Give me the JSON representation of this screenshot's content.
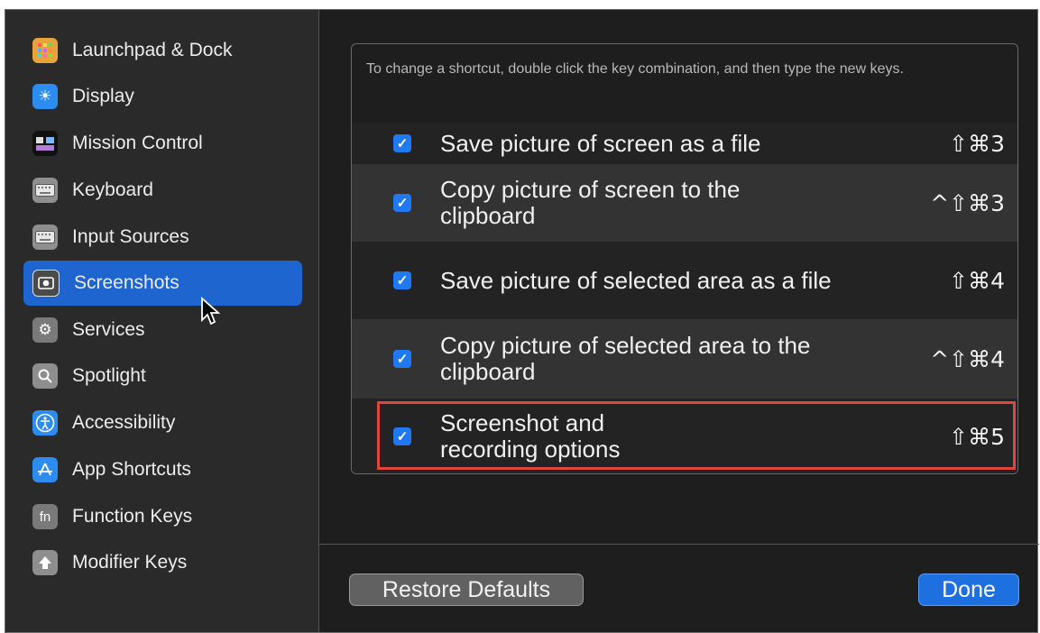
{
  "sidebar": {
    "items": [
      {
        "label": "Launchpad & Dock",
        "icon": "launchpad-icon",
        "color": "#e8a33a",
        "glyph": "▦"
      },
      {
        "label": "Display",
        "icon": "display-icon",
        "color": "#2d8cf0",
        "glyph": "☀"
      },
      {
        "label": "Mission Control",
        "icon": "mission-control-icon",
        "color": "#1a1a1a",
        "glyph": "▚"
      },
      {
        "label": "Keyboard",
        "icon": "keyboard-icon",
        "color": "#8e8e8e",
        "glyph": "⌨"
      },
      {
        "label": "Input Sources",
        "icon": "input-sources-icon",
        "color": "#8e8e8e",
        "glyph": "⌨"
      },
      {
        "label": "Screenshots",
        "icon": "screenshots-icon",
        "color": "#6e6e6e",
        "glyph": "◉"
      },
      {
        "label": "Services",
        "icon": "services-icon",
        "color": "#7a7a7a",
        "glyph": "⚙"
      },
      {
        "label": "Spotlight",
        "icon": "spotlight-icon",
        "color": "#8e8e8e",
        "glyph": "⌕"
      },
      {
        "label": "Accessibility",
        "icon": "accessibility-icon",
        "color": "#2d8cf0",
        "glyph": "♿"
      },
      {
        "label": "App Shortcuts",
        "icon": "app-shortcuts-icon",
        "color": "#2d8cf0",
        "glyph": "A"
      },
      {
        "label": "Function Keys",
        "icon": "function-keys-icon",
        "color": "#7a7a7a",
        "glyph": "fn"
      },
      {
        "label": "Modifier Keys",
        "icon": "modifier-keys-icon",
        "color": "#8e8e8e",
        "glyph": "⬆"
      }
    ],
    "selected_index": 5
  },
  "shortcuts": {
    "instructions": "To change a shortcut, double click the key combination, and then type the new keys.",
    "rows": [
      {
        "label": "Save picture of screen as a file",
        "keys": "⇧⌘3",
        "checked": true
      },
      {
        "label": "Copy picture of screen to the clipboard",
        "keys": "^⇧⌘3",
        "checked": true
      },
      {
        "label": "Save picture of selected area as a file",
        "keys": "⇧⌘4",
        "checked": true
      },
      {
        "label": "Copy picture of selected area to the clipboard",
        "keys": "^⇧⌘4",
        "checked": true
      },
      {
        "label": "Screenshot and recording options",
        "keys": "⇧⌘5",
        "checked": true
      }
    ],
    "highlight_color": "#e0463c"
  },
  "buttons": {
    "restore_label": "Restore Defaults",
    "done_label": "Done"
  },
  "colors": {
    "accent": "#1e6fe0",
    "selection": "#1e65d0"
  }
}
